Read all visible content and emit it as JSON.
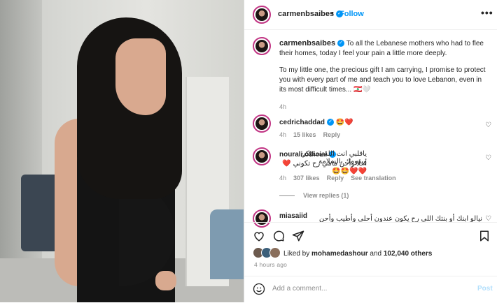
{
  "post": {
    "username": "carmenbsaibes",
    "follow_label": "Follow",
    "dot_separator": "•",
    "more_label": "•••",
    "caption_p1": "To all the Lebanese mothers who had to flee their homes, today I feel your pain a little more deeply.",
    "caption_p2": "To my little one, the precious gift I am carrying, I promise to protect you with every part of me and teach you to love Lebanon, even in its most difficult times... 🇱🇧🤍",
    "caption_time": "4h"
  },
  "comments": [
    {
      "username": "cedrichaddad",
      "text": "🤩❤️",
      "time": "4h",
      "likes": "15 likes",
      "reply": "Reply"
    },
    {
      "username": "nourali.official",
      "text_line1": "ياقلبي انت الله يحميكن ويقومك بالسلامة",
      "text_line2": "أحلا وأحن مامي رح تكوني ❤️❤️❤️🤩🤩",
      "time": "4h",
      "likes": "307 likes",
      "reply": "Reply",
      "see_translation": "See translation",
      "view_replies": "View replies (1)"
    },
    {
      "username": "miasaiid",
      "text": "نيالو ابنك أو بنتك اللي رح يكون عندون أحلى وأطيب وأحن"
    }
  ],
  "footer": {
    "liked_by_prefix": "Liked by",
    "liked_by_user": "mohamedashour",
    "liked_by_and": "and",
    "liked_by_others": "102,040 others",
    "time": "4 hours ago",
    "add_comment_placeholder": "Add a comment...",
    "post_label": "Post"
  },
  "colors": {
    "accent": "#0095f6",
    "ring": "#c13584"
  }
}
